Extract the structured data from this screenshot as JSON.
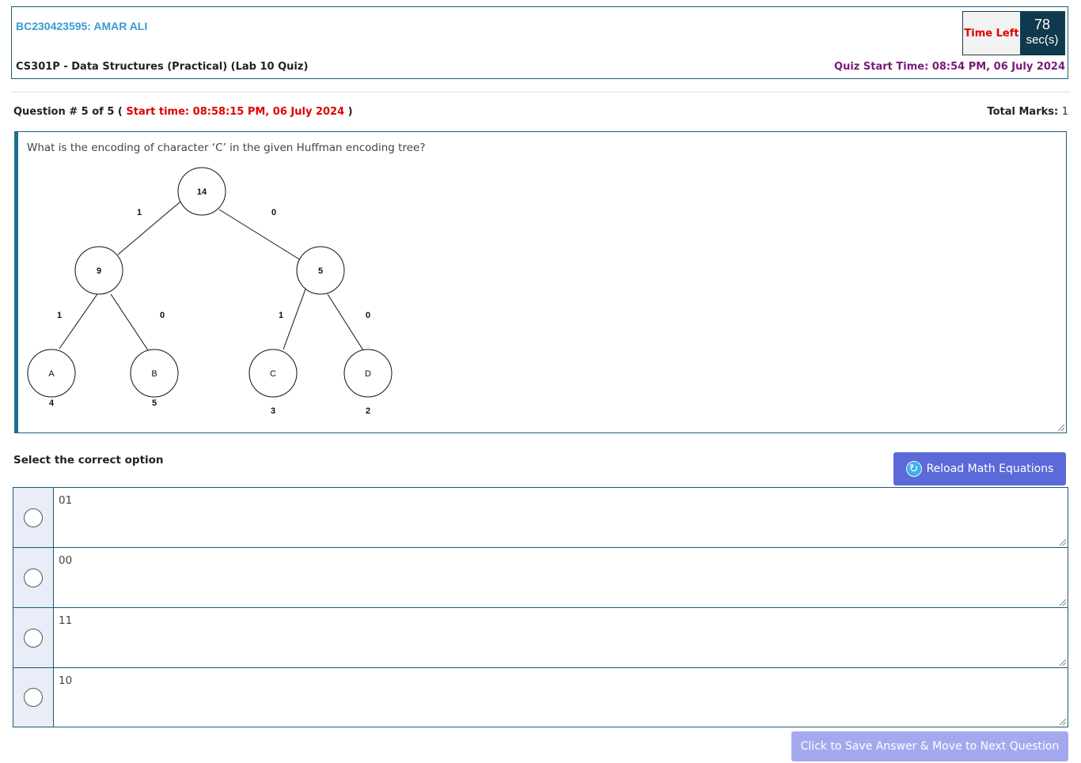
{
  "header": {
    "student": "BC230423595: AMAR ALI",
    "course": "CS301P - Data Structures (Practical) (Lab 10 Quiz)",
    "quiz_start": "Quiz Start Time: 08:54 PM, 06 July 2024",
    "timer": {
      "label": "Time Left",
      "value": "78",
      "unit": "sec(s)"
    }
  },
  "question": {
    "number_text": "Question # 5 of 5 (",
    "start_time": "Start time: 08:58:15 PM, 06 July 2024",
    "close_paren": ")",
    "total_marks_label": "Total Marks:",
    "total_marks_value": "1",
    "text": "What is the encoding of character ‘C’ in the given Huffman encoding tree?",
    "tree": {
      "nodes": [
        {
          "id": "root",
          "label": "14"
        },
        {
          "id": "n9",
          "label": "9"
        },
        {
          "id": "n5",
          "label": "5"
        },
        {
          "id": "A",
          "label": "A",
          "weight": "4"
        },
        {
          "id": "B",
          "label": "B",
          "weight": "5"
        },
        {
          "id": "C",
          "label": "C",
          "weight": "3"
        },
        {
          "id": "D",
          "label": "D",
          "weight": "2"
        }
      ],
      "edges": [
        {
          "from": "root",
          "to": "n9",
          "label": "1"
        },
        {
          "from": "root",
          "to": "n5",
          "label": "0"
        },
        {
          "from": "n9",
          "to": "A",
          "label": "1"
        },
        {
          "from": "n9",
          "to": "B",
          "label": "0"
        },
        {
          "from": "n5",
          "to": "C",
          "label": "1"
        },
        {
          "from": "n5",
          "to": "D",
          "label": "0"
        }
      ]
    }
  },
  "answers": {
    "prompt": "Select the correct option",
    "reload_label": "Reload Math Equations",
    "options": [
      {
        "text": "01"
      },
      {
        "text": "00"
      },
      {
        "text": "11"
      },
      {
        "text": "10"
      }
    ],
    "save_label": "Click to Save Answer & Move to Next Question"
  }
}
